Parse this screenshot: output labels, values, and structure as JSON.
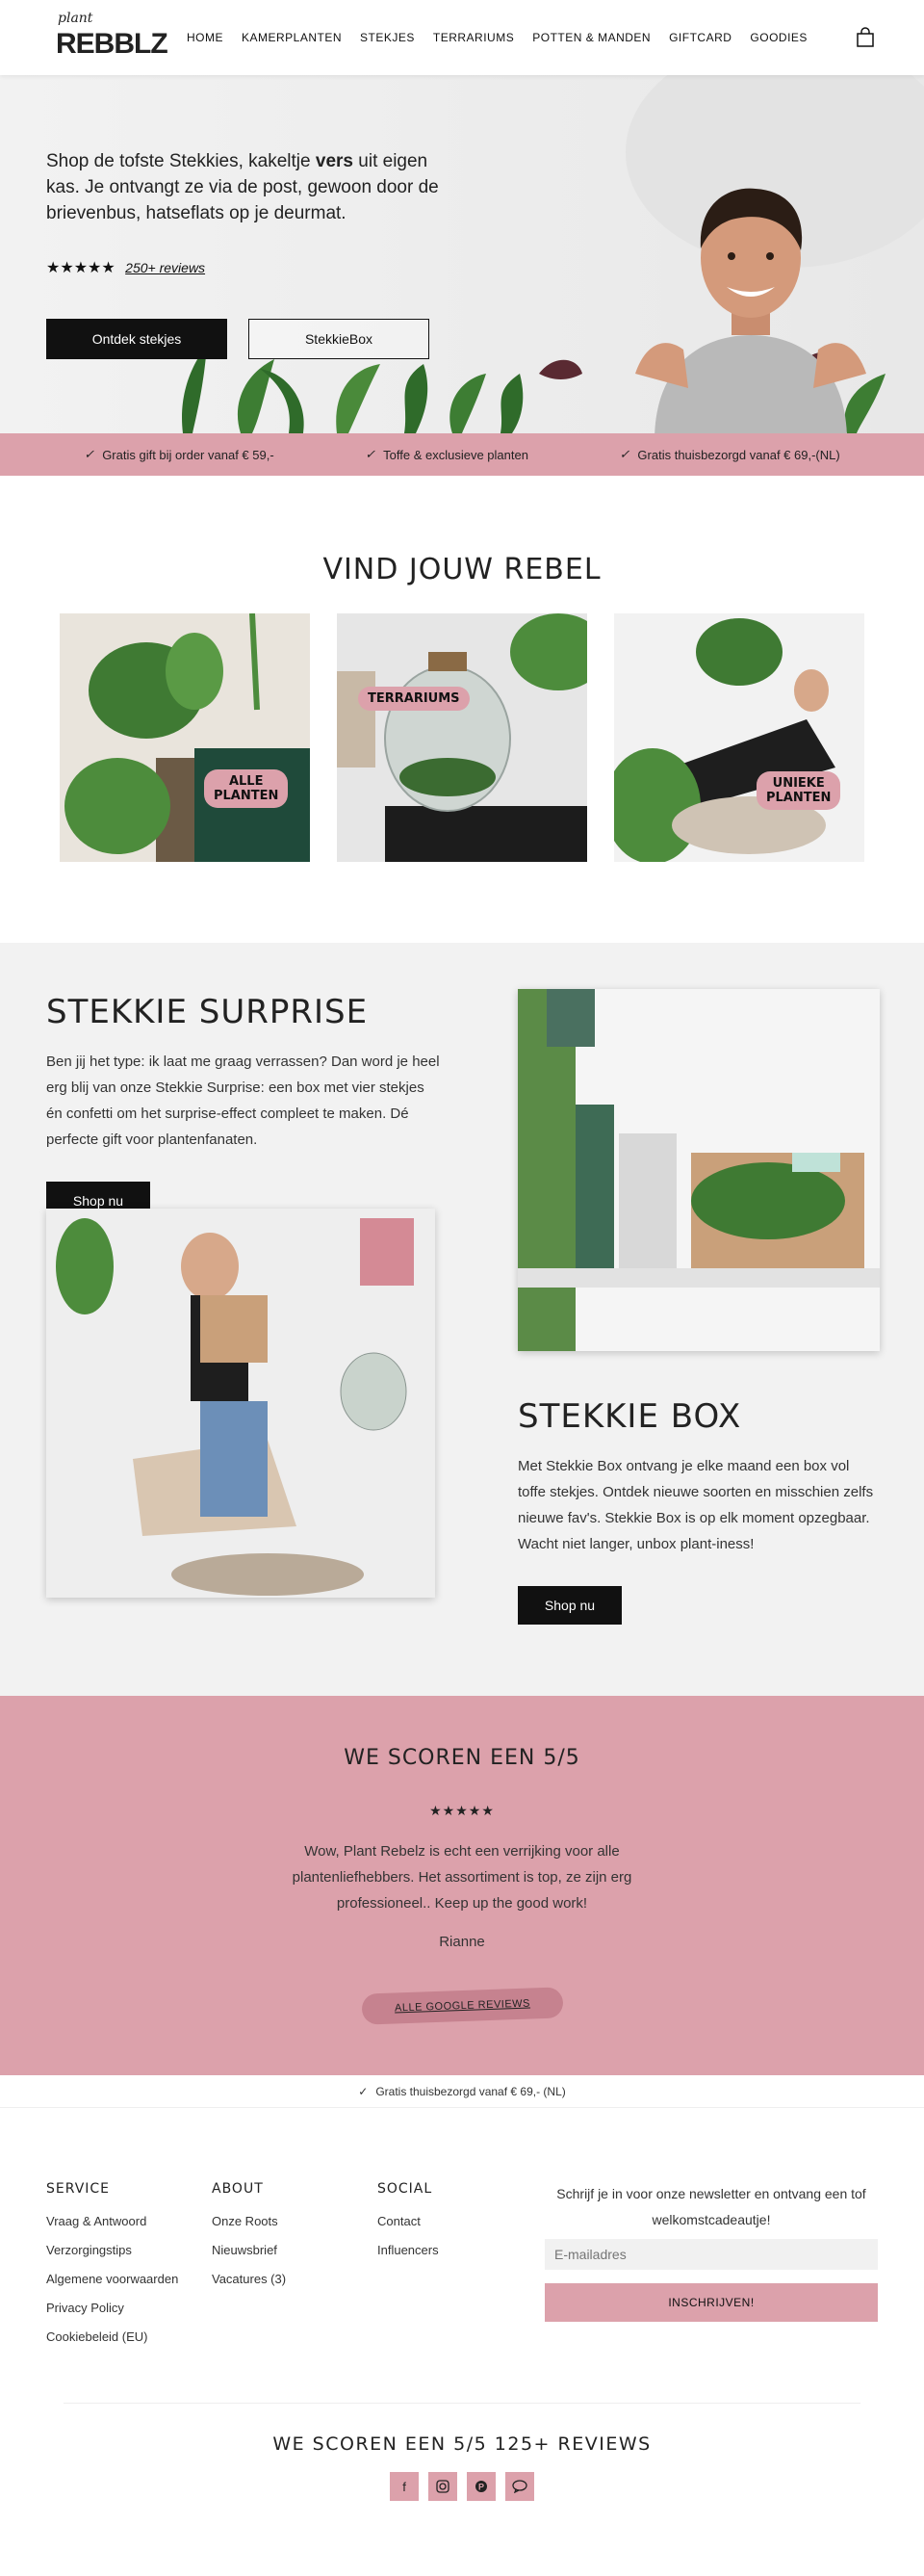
{
  "header": {
    "logo_top": "plant",
    "logo_main": "REBBLZ",
    "nav": [
      "HOME",
      "KAMERPLANTEN",
      "STEKJES",
      "TERRARIUMS",
      "POTTEN & MANDEN",
      "GIFTCARD",
      "GOODIES"
    ],
    "cart_icon": "shopping-bag-icon"
  },
  "hero": {
    "line1_pre": "Shop de tofste Stekkies, kakeltje ",
    "line1_bold": "vers",
    "line1_post": " uit eigen kas.",
    "line2": "Je ontvangt ze via de post, gewoon door de brievenbus, hatseflats op je deurmat.",
    "stars": "★★★★★",
    "reviews_link": "250+ reviews",
    "btn_primary": "Ontdek stekjes",
    "btn_secondary": "StekkieBox"
  },
  "usps": [
    "Gratis gift bij order vanaf € 59,-",
    "Toffe & exclusieve planten",
    "Gratis thuisbezorgd vanaf € 69,-(NL)"
  ],
  "rebel": {
    "title": "VIND JOUW REBEL",
    "cards": [
      {
        "tag_line1": "ALLE",
        "tag_line2": "PLANTEN"
      },
      {
        "tag_line1": "TERRARIUMS",
        "tag_line2": ""
      },
      {
        "tag_line1": "UNIEKE",
        "tag_line2": "PLANTEN"
      }
    ]
  },
  "surprise": {
    "title": "STEKKIE SURPRISE",
    "text": "Ben jij het type: ik laat me graag verrassen? Dan word je heel erg blij van onze Stekkie Surprise: een box met vier stekjes én confetti om het surprise-effect compleet te maken. Dé perfecte gift voor plantenfanaten.",
    "button": "Shop nu"
  },
  "box": {
    "title": "STEKKIE BOX",
    "text": "Met Stekkie Box ontvang je elke maand een box vol toffe stekjes. Ontdek nieuwe soorten en misschien zelfs nieuwe fav's. Stekkie Box is op elk moment opzegbaar. Wacht niet langer, unbox plant-iness!",
    "button": "Shop nu"
  },
  "reviews": {
    "title": "WE SCOREN EEN 5/5",
    "stars": "★★★★★",
    "quote": "Wow, Plant Rebelz is echt een verrijking voor alle plantenliefhebbers. Het assortiment is top, ze zijn erg professioneel.. Keep up the good work!",
    "author": "Rianne",
    "button": "ALLE GOOGLE REVIEWS"
  },
  "thin_usp": "Gratis thuisbezorgd vanaf € 69,- (NL)",
  "footer": {
    "service": {
      "title": "SERVICE",
      "items": [
        "Vraag & Antwoord",
        "Verzorgingstips",
        "Algemene voorwaarden",
        "Privacy Policy",
        "Cookiebeleid (EU)"
      ]
    },
    "about": {
      "title": "ABOUT",
      "items": [
        "Onze Roots",
        "Nieuwsbrief",
        "Vacatures (3)"
      ]
    },
    "social": {
      "title": "SOCIAL",
      "items": [
        "Contact",
        "Influencers"
      ]
    },
    "newsletter": {
      "text": "Schrijf je in voor onze newsletter en ontvang een tof welkomstcadeautje!",
      "placeholder": "E-mailadres",
      "button": "INSCHRIJVEN!"
    },
    "bottom_title": "WE SCOREN EEN 5/5 125+ REVIEWS",
    "socials": [
      "facebook-icon",
      "instagram-icon",
      "pinterest-icon",
      "chat-icon"
    ]
  },
  "colors": {
    "pink": "#dca1ab",
    "dark": "#111111",
    "grey_bg": "#f2f2f2"
  }
}
